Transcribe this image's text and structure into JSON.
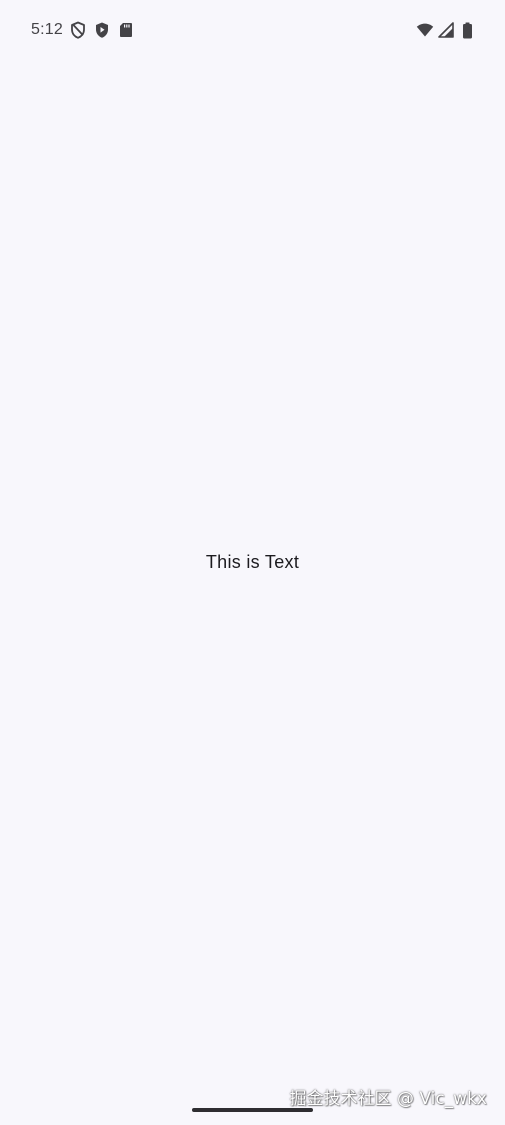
{
  "status_bar": {
    "time": "5:12",
    "left_icons": [
      "vpn-shield-outline-icon",
      "shield-play-icon",
      "sd-card-icon"
    ],
    "right_icons": [
      "wifi-icon",
      "cellular-signal-icon",
      "battery-icon"
    ],
    "icon_color": "#444347"
  },
  "main": {
    "text": "This is Text"
  },
  "watermark": {
    "text": "掘金技术社区 @ Vic_wkx"
  },
  "theme": {
    "background": "#F8F7FC",
    "text_color": "#1C1B1F",
    "nav_handle_color": "#2E2D31"
  }
}
